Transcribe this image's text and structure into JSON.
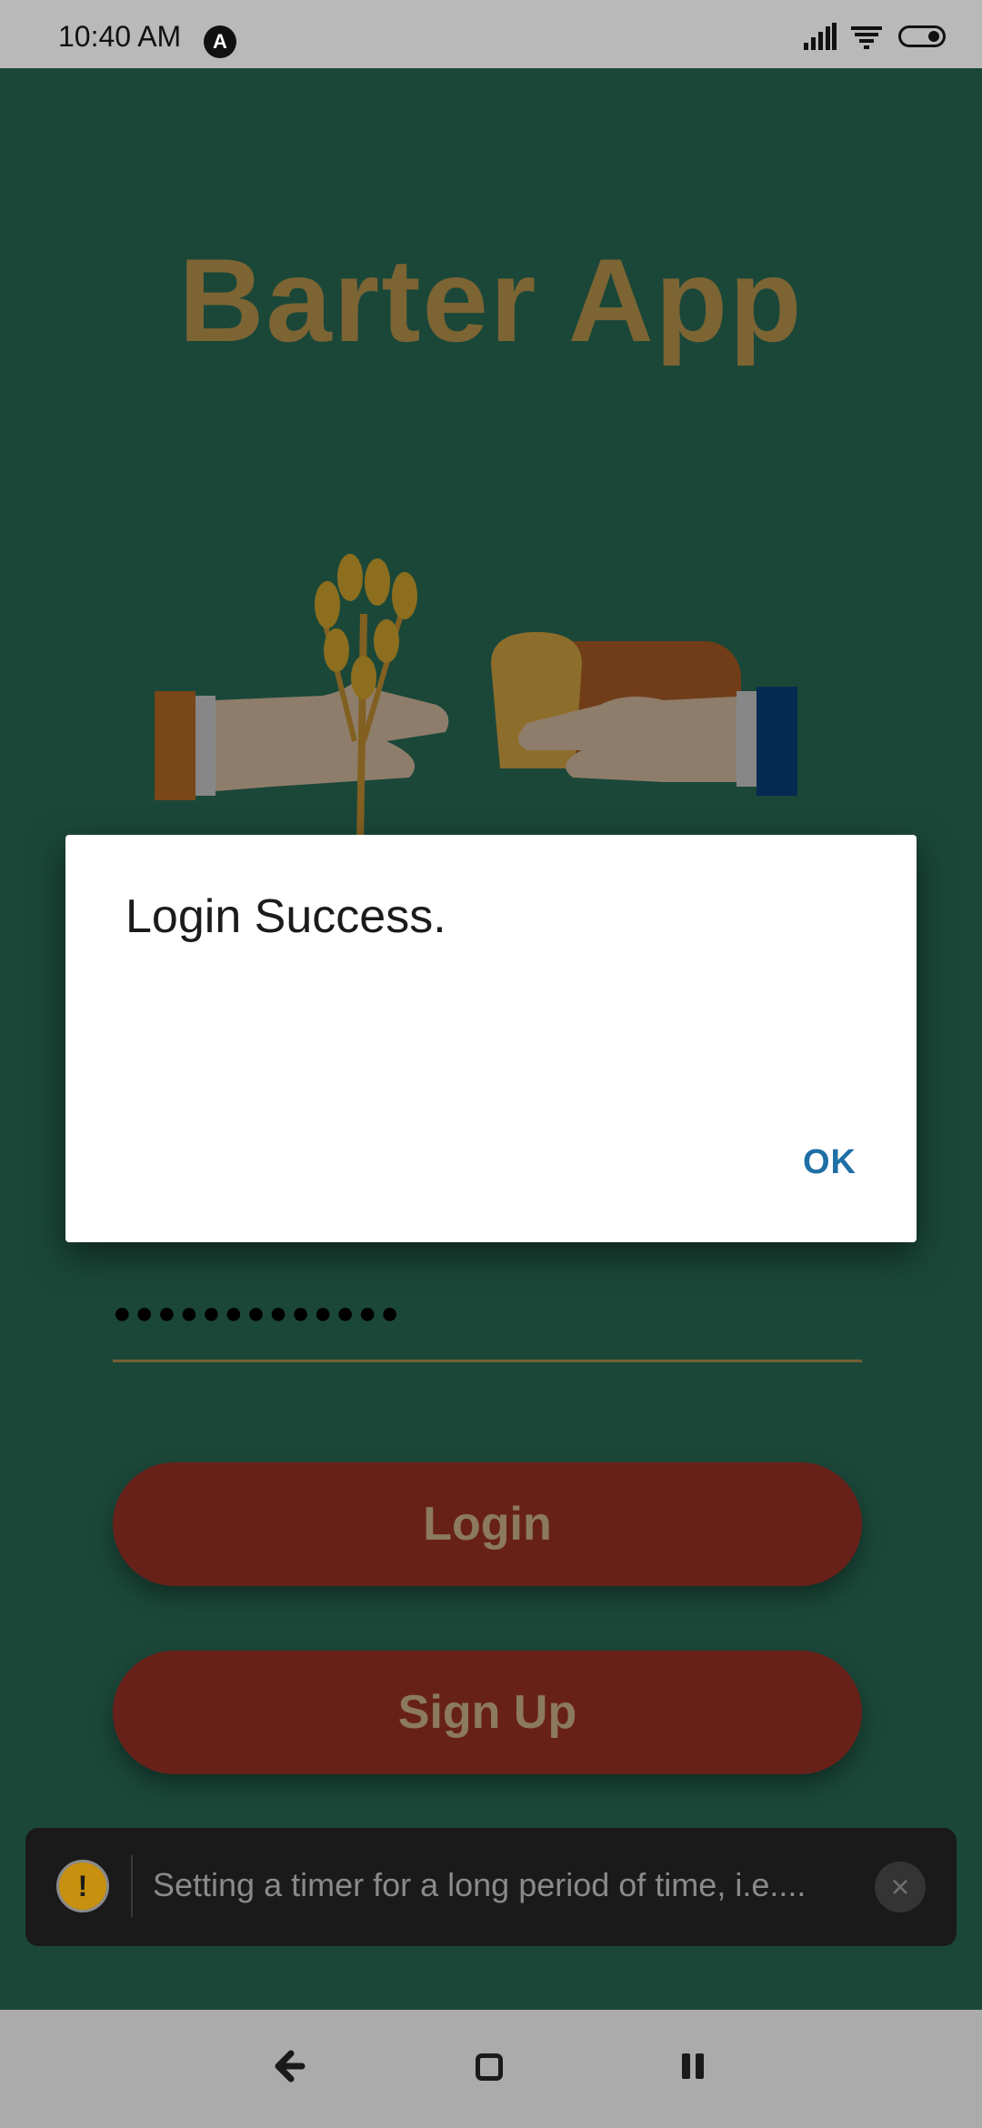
{
  "status_bar": {
    "time": "10:40 AM",
    "app_icon": "A",
    "icons": [
      "signal-icon",
      "wifi-icon",
      "battery-toggle-icon"
    ]
  },
  "app": {
    "title": "Barter App",
    "password_mask": "●●●●●●●●●●●●●",
    "login_label": "Login",
    "signup_label": "Sign Up",
    "colors": {
      "background": "#2f7a62",
      "title": "#d6ad58",
      "button": "#b33a2b",
      "button_text": "#f1d3a0"
    }
  },
  "dialog": {
    "message": "Login Success.",
    "ok_label": "OK"
  },
  "toast": {
    "icon": "!",
    "text": "Setting a timer for a long period of time, i.e....",
    "close_icon": "×"
  },
  "nav": {
    "icons": [
      "back-icon",
      "home-icon",
      "recents-icon"
    ]
  }
}
